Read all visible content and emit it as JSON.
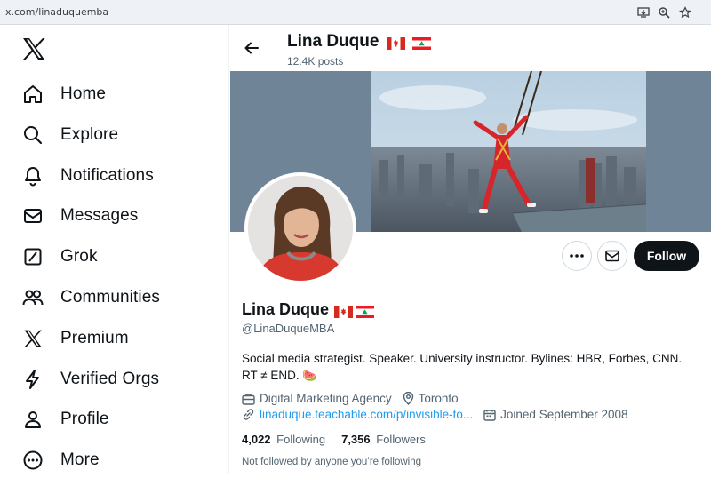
{
  "browser": {
    "url": "x.com/linaduquemba"
  },
  "sidebar": {
    "logo": "x-logo-icon",
    "items": [
      {
        "label": "Home",
        "icon": "home-icon"
      },
      {
        "label": "Explore",
        "icon": "search-icon"
      },
      {
        "label": "Notifications",
        "icon": "bell-icon"
      },
      {
        "label": "Messages",
        "icon": "mail-icon"
      },
      {
        "label": "Grok",
        "icon": "grok-icon"
      },
      {
        "label": "Communities",
        "icon": "communities-icon"
      },
      {
        "label": "Premium",
        "icon": "x-premium-icon"
      },
      {
        "label": "Verified Orgs",
        "icon": "lightning-icon"
      },
      {
        "label": "Profile",
        "icon": "person-icon"
      },
      {
        "label": "More",
        "icon": "more-circle-icon"
      }
    ]
  },
  "header": {
    "name": "Lina Duque",
    "posts": "12.4K posts"
  },
  "profile": {
    "name": "Lina Duque",
    "handle": "@LinaDuqueMBA",
    "bio_line1": "Social media strategist. Speaker. University instructor. Bylines: HBR, Forbes, CNN.",
    "bio_line2": "RT ≠ END. 🍉",
    "category": "Digital Marketing Agency",
    "location": "Toronto",
    "link": "linaduque.teachable.com/p/invisible-to...",
    "joined": "Joined September 2008",
    "following_count": "4,022",
    "following_label": "Following",
    "followers_count": "7,356",
    "followers_label": "Followers",
    "not_followed": "Not followed by anyone you’re following",
    "follow_label": "Follow"
  },
  "colors": {
    "accent": "#1d9bf0",
    "text": "#0f1419",
    "muted": "#536471",
    "banner": "#6f8496"
  }
}
